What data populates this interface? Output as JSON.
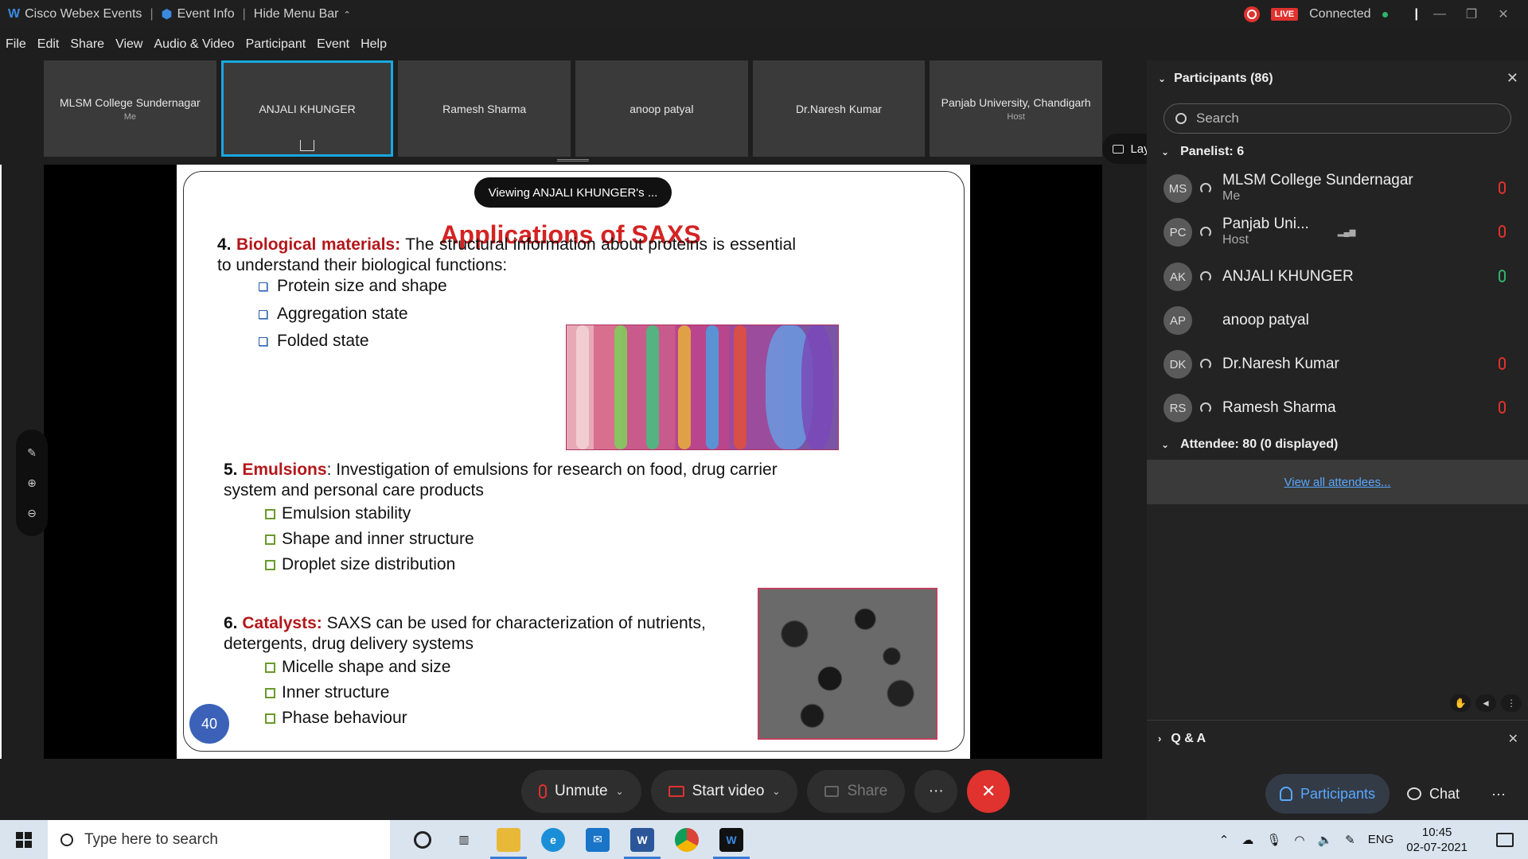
{
  "titlebar": {
    "app_name": "Cisco Webex Events",
    "event_info": "Event Info",
    "hide_menu": "Hide Menu Bar",
    "live_badge": "LIVE",
    "status": "Connected"
  },
  "menu": [
    "File",
    "Edit",
    "Share",
    "View",
    "Audio & Video",
    "Participant",
    "Event",
    "Help"
  ],
  "tiles": [
    {
      "name": "MLSM College Sundernagar",
      "sub": "Me"
    },
    {
      "name": "ANJALI KHUNGER",
      "sub": ""
    },
    {
      "name": "Ramesh Sharma",
      "sub": ""
    },
    {
      "name": "anoop patyal",
      "sub": ""
    },
    {
      "name": "Dr.Naresh Kumar",
      "sub": ""
    },
    {
      "name": "Panjab University, Chandigarh",
      "sub": "Host"
    }
  ],
  "layout_button": "Layout",
  "slide": {
    "viewing_banner": "Viewing ANJALI KHUNGER's ...",
    "title": "Applications of SAXS",
    "s4_num": "4.",
    "s4_head": "Biological materials:",
    "s4_text": " The structural information about proteins is essential to understand their biological functions:",
    "s4_bullets": [
      "Protein size and shape",
      "Aggregation state",
      "Folded state"
    ],
    "s5_num": "5.",
    "s5_head": "Emulsions",
    "s5_text": ": Investigation of emulsions for research on food, drug carrier system and personal care products",
    "s5_bullets": [
      "Emulsion stability",
      "Shape and inner structure",
      "Droplet size distribution"
    ],
    "s6_num": "6.",
    "s6_head": "Catalysts:",
    "s6_text": " SAXS can be used for characterization of nutrients, detergents, drug delivery systems",
    "s6_bullets": [
      "Micelle shape and size",
      "Inner structure",
      "Phase behaviour"
    ],
    "page_number": "40"
  },
  "controls": {
    "unmute": "Unmute",
    "start_video": "Start video",
    "share": "Share",
    "more": "···"
  },
  "panel": {
    "title": "Participants (86)",
    "search_placeholder": "Search",
    "panelist_header": "Panelist: 6",
    "panelists": [
      {
        "initials": "MS",
        "name": "MLSM College Sundernagar",
        "sub": "Me"
      },
      {
        "initials": "PC",
        "name": "Panjab Uni...",
        "sub": "Host"
      },
      {
        "initials": "AK",
        "name": "ANJALI KHUNGER",
        "sub": ""
      },
      {
        "initials": "AP",
        "name": "anoop patyal",
        "sub": ""
      },
      {
        "initials": "DK",
        "name": "Dr.Naresh Kumar",
        "sub": ""
      },
      {
        "initials": "RS",
        "name": "Ramesh Sharma",
        "sub": ""
      }
    ],
    "attendee_header": "Attendee: 80 (0 displayed)",
    "view_all": "View all attendees...",
    "qa": "Q & A",
    "participants_tab": "Participants",
    "chat_tab": "Chat"
  },
  "taskbar": {
    "search_placeholder": "Type here to search",
    "lang": "ENG",
    "time": "10:45",
    "date": "02-07-2021"
  },
  "colors": {
    "accent": "#18a8e0",
    "slide_title": "#d42323",
    "section_head": "#b3171b",
    "end_call": "#e0322e",
    "link": "#58a8ff"
  }
}
